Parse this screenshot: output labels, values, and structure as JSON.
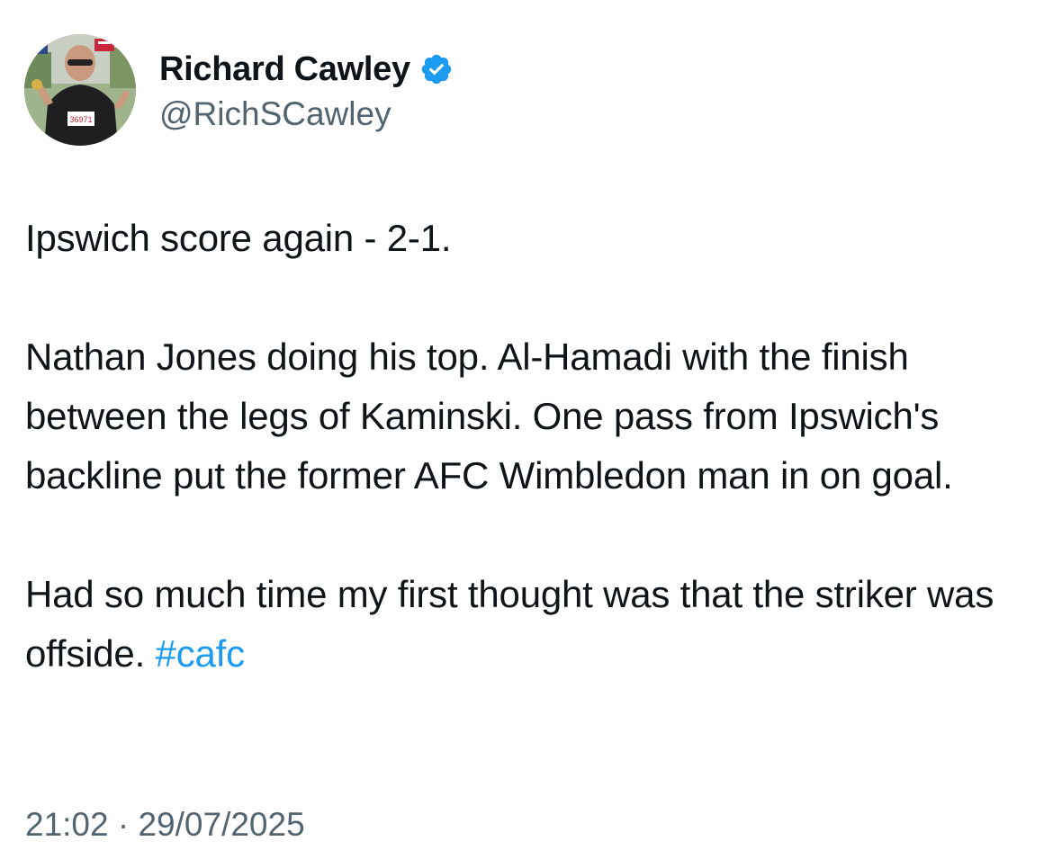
{
  "tweet": {
    "author": {
      "display_name": "Richard Cawley",
      "handle": "@RichSCawley",
      "verified": true,
      "verified_icon": "verified-badge-icon",
      "verified_color": "#1d9bf0",
      "avatar_bib_number": "36971"
    },
    "paragraphs": [
      "Ipswich score again - 2-1.",
      "Nathan Jones doing his top. Al-Hamadi with the finish between the legs of Kaminski. One pass from Ipswich's backline put the former AFC Wimbledon man in on goal."
    ],
    "last_paragraph_text": "Had so much time my first thought was that the striker was offside. ",
    "hashtag": "#cafc",
    "hashtag_color": "#1d9bf0",
    "time": "21:02",
    "date": "29/07/2025",
    "separator": " · "
  }
}
